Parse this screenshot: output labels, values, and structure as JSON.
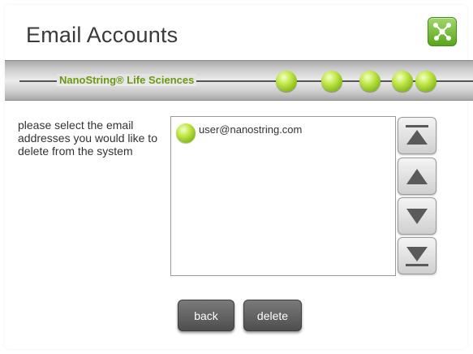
{
  "header": {
    "title": "Email Accounts",
    "app_icon": "network-icon"
  },
  "banner": {
    "brand": "NanoString® Life Sciences",
    "accent_color": "#86bb17"
  },
  "main": {
    "instruction": "please select the email addresses you would like to delete from the system",
    "email_list": [
      {
        "label": "user@nanostring.com"
      }
    ]
  },
  "scroll_controls": {
    "icons": [
      "scroll-top-icon",
      "scroll-up-icon",
      "scroll-down-icon",
      "scroll-bottom-icon"
    ]
  },
  "actions": {
    "back_label": "back",
    "delete_label": "delete"
  }
}
